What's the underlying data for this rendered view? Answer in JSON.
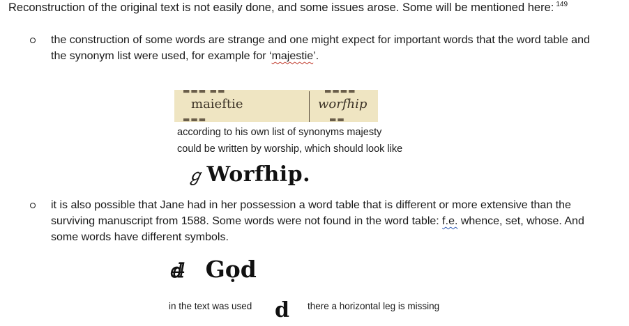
{
  "intro": {
    "text": "Reconstruction of the original text is not easily done, and some issues arose. Some will be mentioned here:",
    "footnote": "149"
  },
  "bullet1": {
    "line1": "the construction of some words are strange and one might expect for important words that the word table and",
    "line2_pre": "the synonym list were used, for example for ‘",
    "line2_word": "majestie",
    "line2_post": "’."
  },
  "dictionary_image": {
    "left_word": "maieftie",
    "right_word": "worfhip"
  },
  "synonym_note": {
    "line1": "according to his own list of synonyms majesty",
    "line2": "could be written by worship, which should look like"
  },
  "worship_glyph": {
    "mark": "♀ƒ",
    "word": "Worfhip."
  },
  "bullet2": {
    "line1": "it is also possible that Jane had in her possession a word table that is different or more extensive than the",
    "line2_pre": "surviving manuscript from 1588. Some words were not found in the word table: ",
    "line2_fe": "f.e.",
    "line2_post": " whence, set, whose. And",
    "line3": "some words have different symbols."
  },
  "god_symbols": {
    "symbol": "ḋ",
    "word": "Gọd"
  },
  "comparison": {
    "left_label": "in the text was used",
    "symbol": "d",
    "right_label": "there a horizontal leg is missing"
  }
}
